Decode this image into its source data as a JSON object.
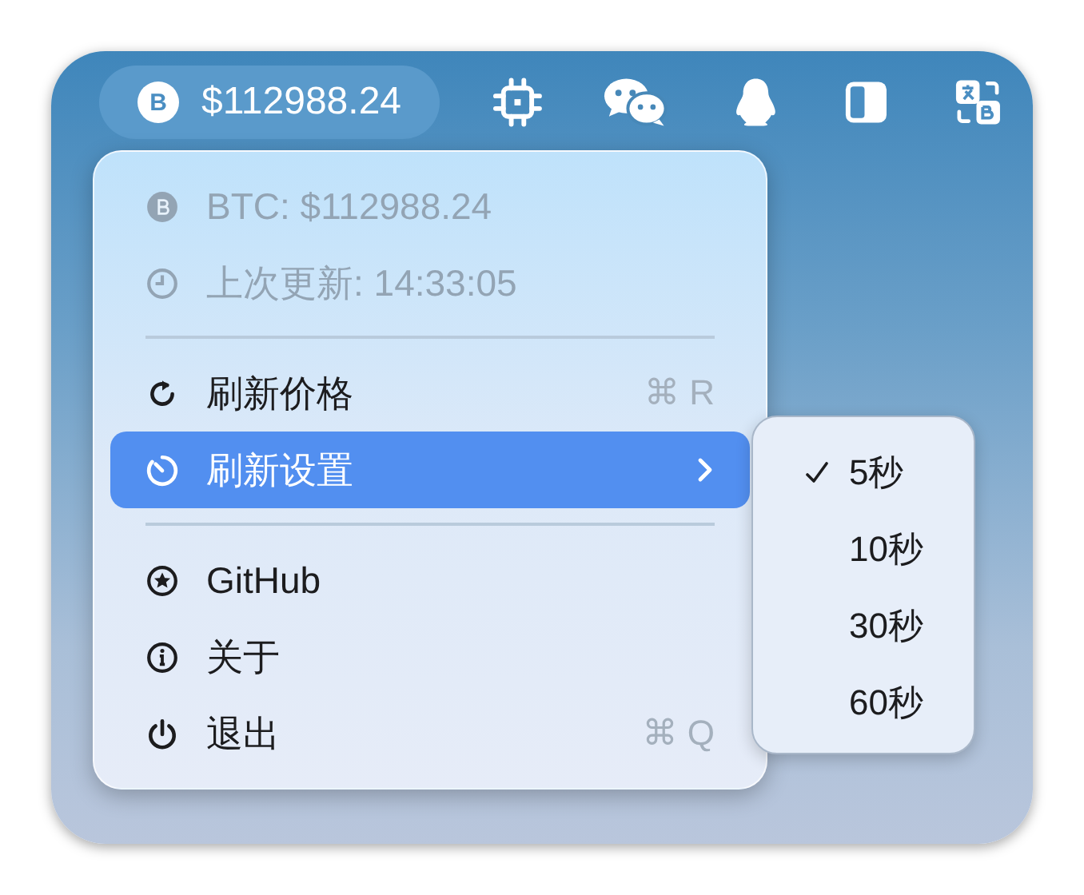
{
  "menu_bar": {
    "price": "$112988.24",
    "coin_symbol": "B"
  },
  "menu": {
    "sections": [
      [
        {
          "kind": "info",
          "label": "BTC: $112988.24",
          "disabled": true,
          "selected": false
        },
        {
          "kind": "info",
          "label": "上次更新: 14:33:05",
          "disabled": true,
          "selected": false
        }
      ],
      [
        {
          "kind": "command",
          "label": "刷新价格",
          "shortcut": "⌘ R",
          "disabled": false,
          "selected": false
        },
        {
          "kind": "submenu",
          "label": "刷新设置",
          "disabled": false,
          "selected": true
        }
      ],
      [
        {
          "kind": "command",
          "label": "GitHub",
          "disabled": false,
          "selected": false
        },
        {
          "kind": "command",
          "label": "关于",
          "disabled": false,
          "selected": false
        },
        {
          "kind": "command",
          "label": "退出",
          "shortcut": "⌘ Q",
          "disabled": false,
          "selected": false
        }
      ]
    ]
  },
  "submenu": {
    "options": [
      {
        "label": "5秒",
        "checked": true
      },
      {
        "label": "10秒",
        "checked": false
      },
      {
        "label": "30秒",
        "checked": false
      },
      {
        "label": "60秒",
        "checked": false
      }
    ]
  }
}
